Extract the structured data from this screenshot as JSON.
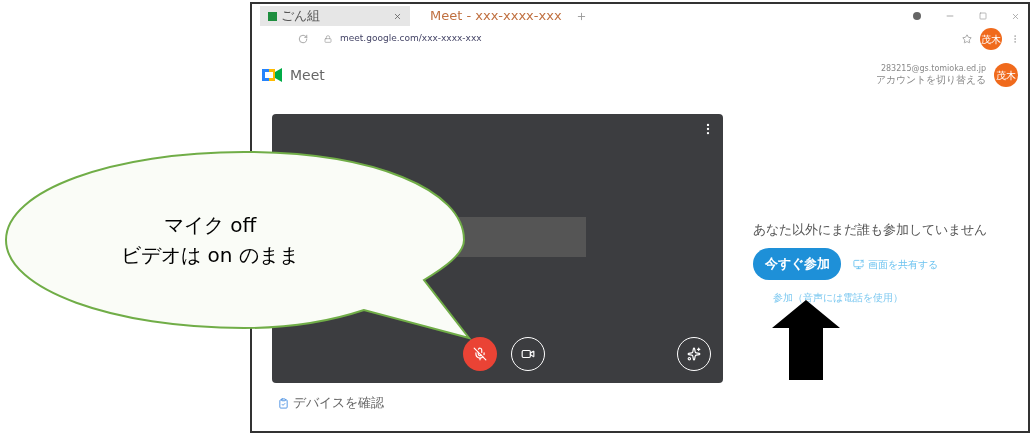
{
  "browser": {
    "tabs": [
      {
        "title": "ごん組",
        "selected": false
      },
      {
        "title": "Meet - xxx-xxxx-xxx",
        "selected": true
      }
    ],
    "address": "meet.google.com/xxx-xxxx-xxx",
    "avatar": "茂木"
  },
  "app_title": "Meet",
  "account": {
    "email": "283215@gs.tomioka.ed.jp",
    "switch_link": "アカウントを切り替える",
    "avatar": "茂木"
  },
  "preview": {
    "mic_on": false,
    "camera_on": true
  },
  "join": {
    "status": "あなた以外にまだ誰も参加していません",
    "join_button": "今すぐ参加",
    "share_button": "画面を共有する",
    "phone_link": "参加（音声には電話を使用）"
  },
  "check_devices": "デバイスを確認",
  "callout": {
    "lines": [
      "マイク off",
      "ビデオは on のまま"
    ]
  }
}
